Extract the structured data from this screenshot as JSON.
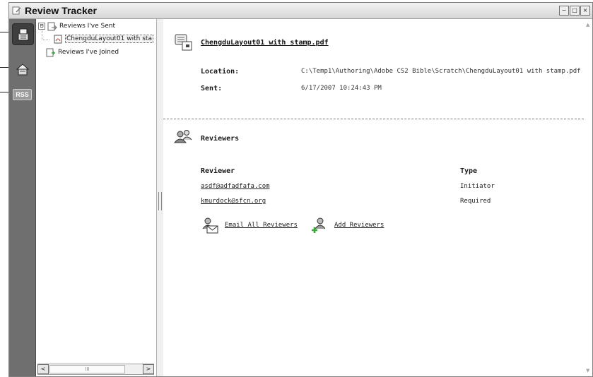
{
  "window": {
    "title": "Review Tracker",
    "title_icon": "review-tracker-icon",
    "controls": {
      "minimize": "−",
      "restore": "□",
      "close": "×"
    }
  },
  "iconbar": {
    "items": [
      {
        "name": "reviews-icon",
        "selected": true
      },
      {
        "name": "shared-reviews-icon",
        "selected": false
      },
      {
        "name": "rss-icon",
        "label": "RSS",
        "selected": false
      }
    ]
  },
  "tree": {
    "items": [
      {
        "label": "Reviews I've Sent",
        "expander": "⊟",
        "icon": "sent-reviews-icon"
      },
      {
        "label": "ChengduLayout01 with sta",
        "icon": "pdf-file-icon",
        "selected": true
      },
      {
        "label": "Reviews I've Joined",
        "icon": "joined-reviews-icon"
      }
    ],
    "scroll": {
      "left": "<",
      "right": ">",
      "thumb_grip": "III"
    }
  },
  "document": {
    "link": "ChengduLayout01 with stamp.pdf",
    "location_label": "Location:",
    "location_value": "C:\\Temp1\\Authoring\\Adobe CS2 Bible\\Scratch\\ChengduLayout01 with stamp.pdf",
    "sent_label": "Sent:",
    "sent_value": "6/17/2007 10:24:43 PM"
  },
  "reviewers": {
    "heading": "Reviewers",
    "col_reviewer": "Reviewer",
    "col_type": "Type",
    "rows": [
      {
        "email": "asdf@adfadfafa.com",
        "type": "Initiator"
      },
      {
        "email": "kmurdock@sfcn.org",
        "type": "Required"
      }
    ],
    "actions": {
      "email_all": "Email All Reviewers",
      "add": "Add Reviewers"
    }
  },
  "colors": {
    "iconbar": "#6f6f6f",
    "iconbar_selected": "#3e3e3e",
    "titlebar_top": "#f2f2f2",
    "titlebar_bottom": "#d6d6d6"
  }
}
